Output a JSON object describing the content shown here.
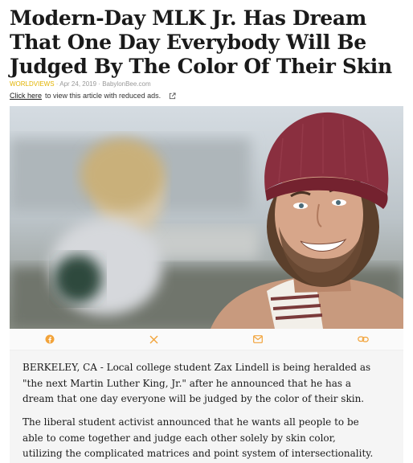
{
  "article": {
    "headline": "Modern-Day MLK Jr. Has Dream That One Day Everybody Will Be Judged By The Color Of Their Skin",
    "category": "WORLDVIEWS",
    "date": "Apr 24, 2019",
    "source": "BabylonBee.com",
    "reduced_ads_link": "Click here",
    "reduced_ads_text": "to view this article with reduced ads."
  },
  "share": {
    "icons": [
      "facebook-icon",
      "x-icon",
      "email-icon",
      "copy-link-icon"
    ],
    "color": "#f2a33a"
  },
  "body": {
    "paragraphs": [
      "BERKELEY, CA - Local college student Zax Lindell is being heralded as \"the next Martin Luther King, Jr.\" after he announced that he has a dream that one day everyone will be judged by the color of their skin.",
      "The liberal student activist announced that he wants all people to be able to come together and judge each other solely by skin color, utilizing the complicated matrices and point system of intersectionality."
    ]
  }
}
